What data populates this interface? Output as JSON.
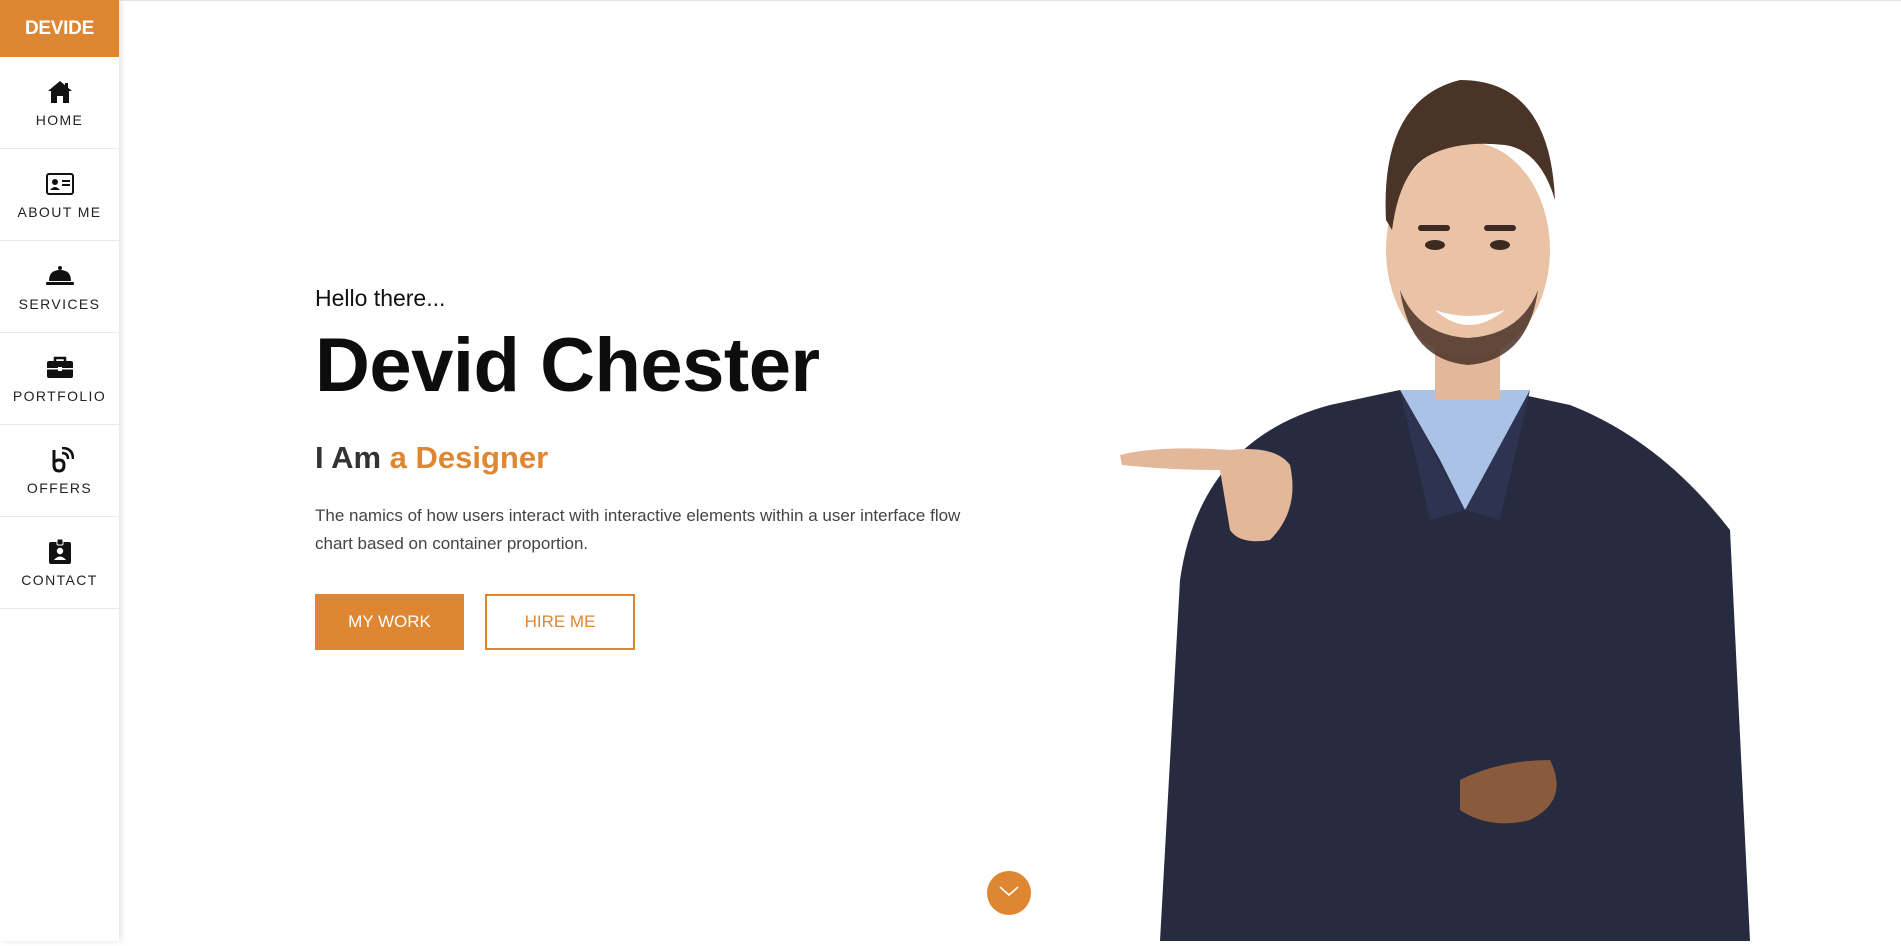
{
  "sidebar": {
    "brand": "DEVIDE",
    "items": [
      {
        "label": "HOME",
        "icon": "home-icon"
      },
      {
        "label": "ABOUT ME",
        "icon": "id-card-icon"
      },
      {
        "label": "SERVICES",
        "icon": "service-bell-icon"
      },
      {
        "label": "PORTFOLIO",
        "icon": "briefcase-icon"
      },
      {
        "label": "OFFERS",
        "icon": "offers-icon"
      },
      {
        "label": "CONTACT",
        "icon": "id-badge-icon"
      }
    ]
  },
  "hero": {
    "greeting": "Hello there...",
    "name": "Devid Chester",
    "role_prefix": "I Am",
    "role_accent": "a Designer",
    "description": "The namics of how users interact with interactive elements within a user interface flow chart based on container proportion.",
    "primary_button": "MY WORK",
    "secondary_button": "HIRE ME"
  },
  "scroll": {
    "icon": "chevron-down-icon"
  },
  "image": {
    "alt": "smiling man pointing"
  },
  "colors": {
    "accent": "#DE8632",
    "text": "#0d0d0d",
    "body": "#444444"
  }
}
